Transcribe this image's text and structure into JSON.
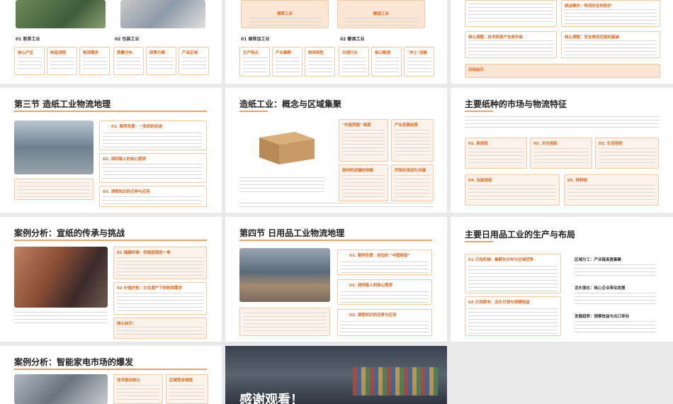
{
  "s1": {
    "sec1": "01 制茶工业",
    "sec2": "02 包装工业",
    "cards": [
      "核心产区",
      "制造流程",
      "物流需求",
      "质量分布",
      "政策方案",
      "产品区域"
    ]
  },
  "s2": {
    "cardA": "烟草工业",
    "cardB": "酿酒工业",
    "sec1": "01 烟草加工业",
    "sec2": "02 酿酒工业",
    "cards": [
      "生产特点",
      "产业集群",
      "物流特性",
      "白酒行业",
      "核心酿酒",
      "\"洋土\"运输"
    ]
  },
  "s3": {
    "t1": "挑战事件：物流安全的防护",
    "t2": "核心调整：技术和资产全面升级",
    "t3": "核心调整：安全是供应链的基础",
    "t4": "总结启示"
  },
  "s4": {
    "title": "第三节 造纸工业物流地理",
    "items": [
      "01. 案例背景：一张纸的足迹",
      "02. 调研路上的核心图表",
      "03. 课程知识的迁移与应用"
    ]
  },
  "s5": {
    "title": "造纸工业：概念与区域集聚",
    "c1": "\"东强西弱\" 格局",
    "c2": "产业发展前景",
    "c3": "原材料运输的依赖",
    "c4": "环保约束成为关键"
  },
  "s6": {
    "title": "主要纸种的市场与物流特征",
    "cards": [
      "01. 新闻纸",
      "02. 文化用纸",
      "03. 生活用纸",
      "04. 包装用纸",
      "05. 特种纸"
    ]
  },
  "s7": {
    "title": "案例分析：宣纸的传承与挑战",
    "c1": "01 福建纤维：传统困境的一角",
    "c2": "02 价值护航：文化遗产下的物流需求",
    "c3": "核心启示："
  },
  "s8": {
    "title": "第四节 日用品工业物流地理",
    "items": [
      "01. 案例背景：身边的 \"中国制造\"",
      "02. 调研路上的核心图表",
      "03. 课程知识的迁移与应用"
    ]
  },
  "s9": {
    "title": "主要日用品工业的生产与布局",
    "c1": "01 日用机械：集群化分布与区域优势",
    "c2": "02 日用家电：龙头引领与规模效益",
    "r1": "区域分工：产业链高度集聚",
    "r2": "龙头强化：核心企业带动发展",
    "r3": "发展趋势：规模效益与出口导向"
  },
  "s10": {
    "title": "案例分析：智能家电市场的爆发",
    "c1": "技术驱动核心",
    "c2": "区域竞合格局"
  },
  "s11": {
    "text": "感谢观看！"
  }
}
